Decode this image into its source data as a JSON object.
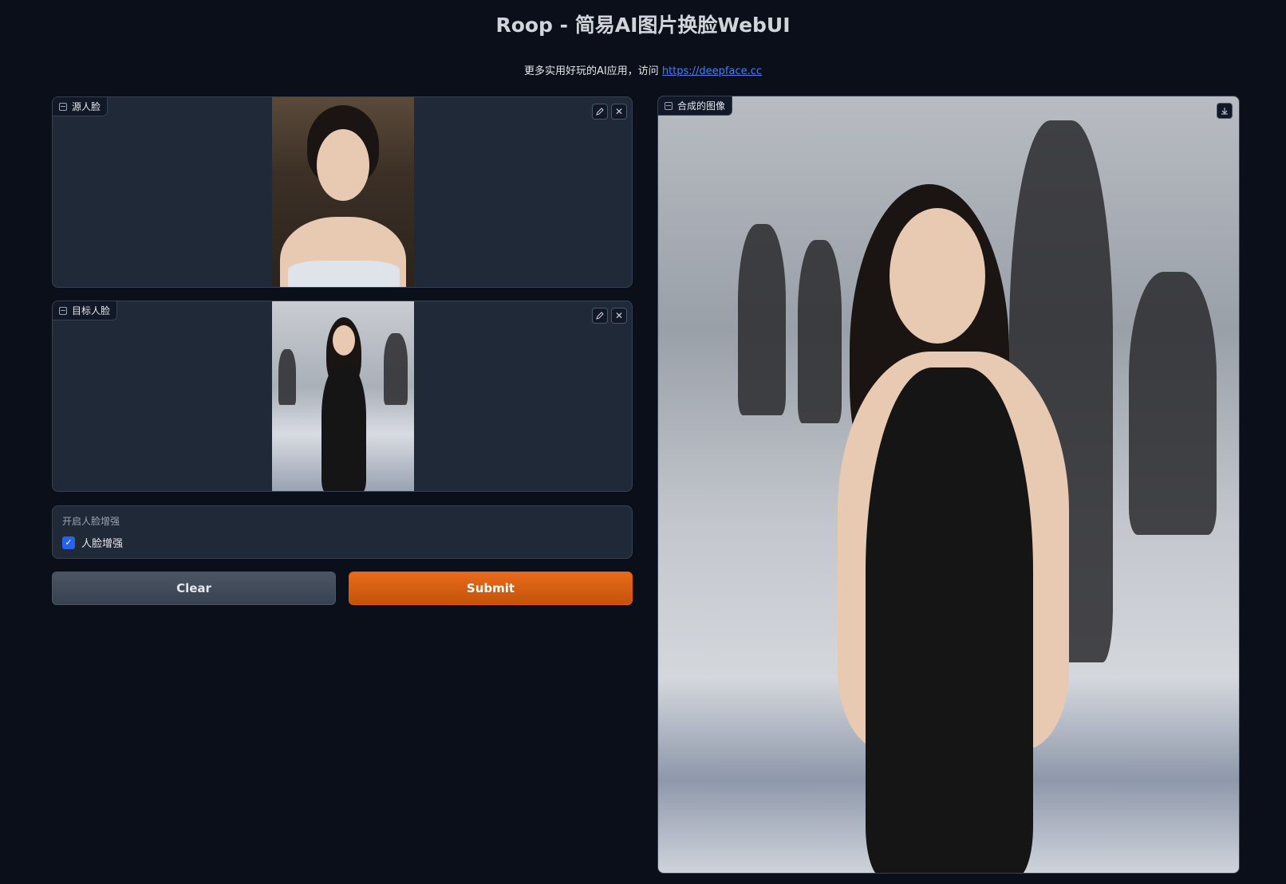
{
  "header": {
    "title": "Roop - 简易AI图片换脸WebUI",
    "subtitle_prefix": "更多实用好玩的AI应用，访问 ",
    "subtitle_link": "https://deepface.cc"
  },
  "source_panel": {
    "label": "源人脸"
  },
  "target_panel": {
    "label": "目标人脸"
  },
  "enhance": {
    "title": "开启人脸增强",
    "checkbox_label": "人脸增强",
    "checked": true
  },
  "buttons": {
    "clear": "Clear",
    "submit": "Submit"
  },
  "result_panel": {
    "label": "合成的图像"
  },
  "colors": {
    "background": "#0b0f19",
    "panel": "#1f2937",
    "accent": "#ea580c",
    "link": "#3b82f6",
    "checkbox": "#2563eb"
  }
}
